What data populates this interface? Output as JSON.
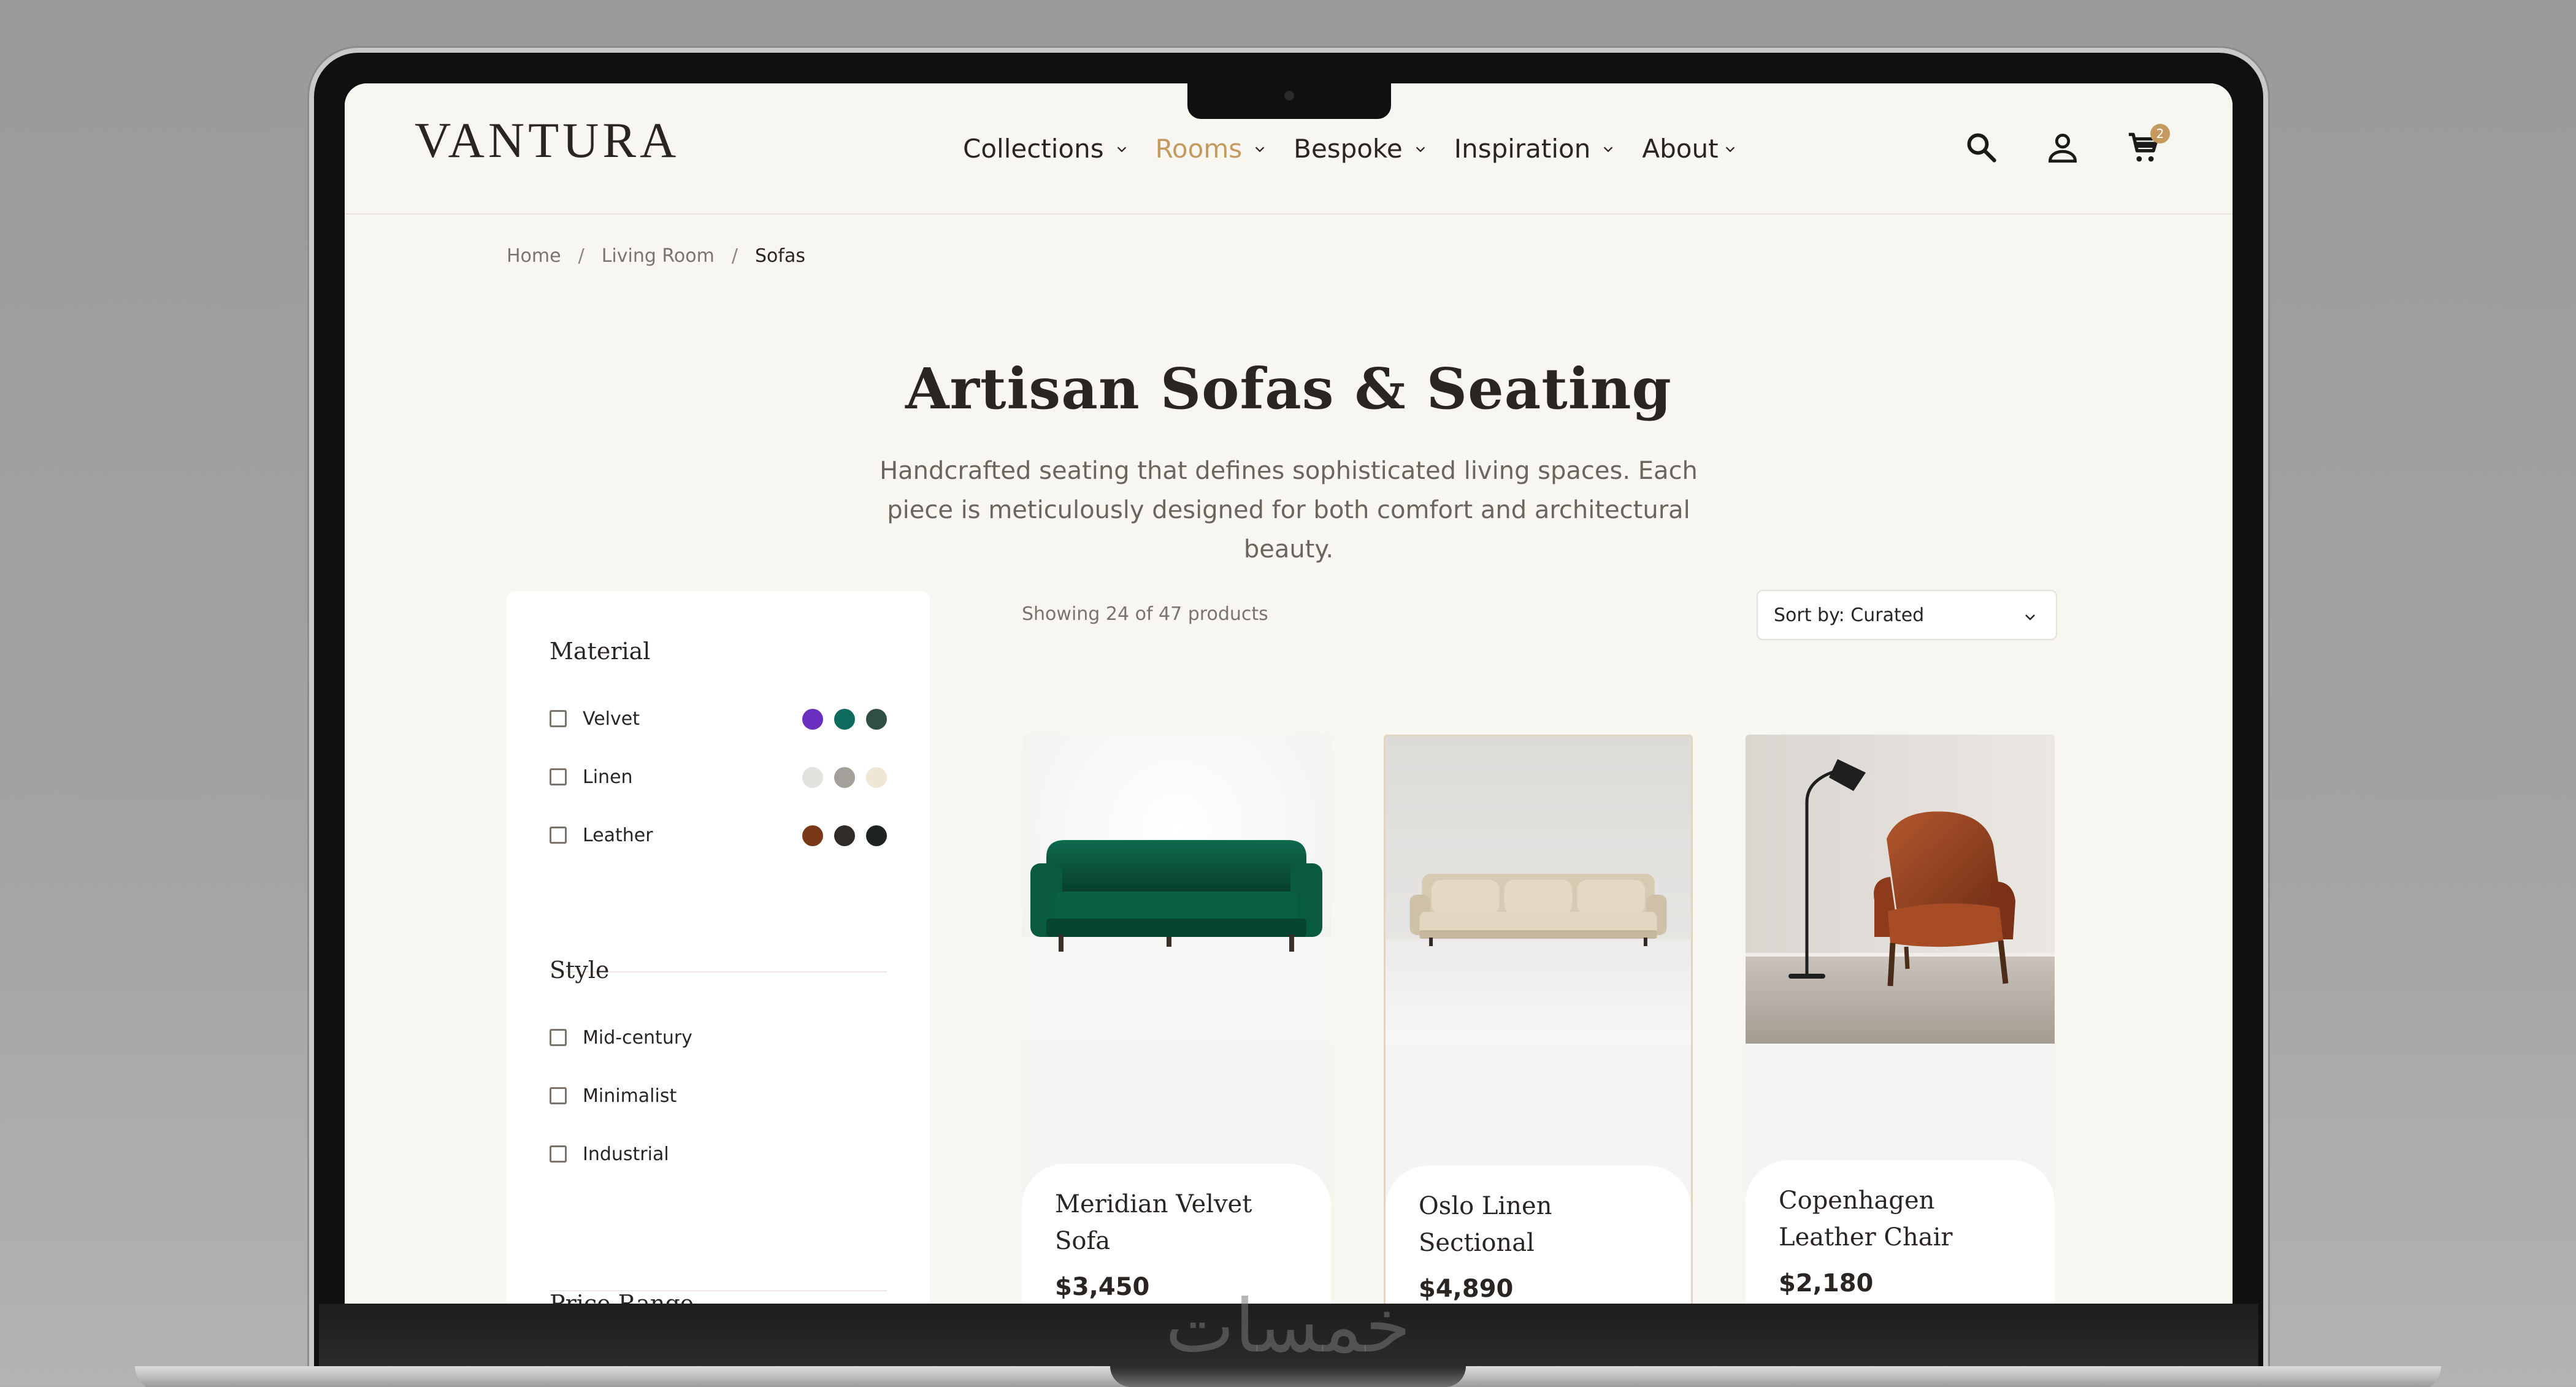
{
  "brand": {
    "logo": "VANTURA"
  },
  "nav": {
    "items": [
      {
        "label": "Collections",
        "active": false
      },
      {
        "label": "Rooms",
        "active": true
      },
      {
        "label": "Bespoke",
        "active": false
      },
      {
        "label": "Inspiration",
        "active": false
      },
      {
        "label": "About",
        "active": false
      }
    ],
    "icons": [
      "search-icon",
      "account-icon",
      "cart-icon"
    ],
    "cart_count": "2"
  },
  "breadcrumb": {
    "home": "Home",
    "sep1": "/",
    "room": "Living Room",
    "sep2": "/",
    "current": "Sofas"
  },
  "page": {
    "title": "Artisan Sofas & Seating",
    "description": "Handcrafted seating that defines sophisticated living spaces. Each piece is meticulously designed for both comfort and architectural beauty."
  },
  "filters": {
    "material": {
      "title": "Material",
      "options": [
        {
          "label": "Velvet",
          "swatches": [
            "#6b2fbf",
            "#0f6b5e",
            "#2f4f46"
          ]
        },
        {
          "label": "Linen",
          "swatches": [
            "#e3e2de",
            "#a39f99",
            "#efe6d3"
          ]
        },
        {
          "label": "Leather",
          "swatches": [
            "#7a3818",
            "#2f2b26",
            "#1d2422"
          ]
        }
      ]
    },
    "style": {
      "title": "Style",
      "options": [
        {
          "label": "Mid-century"
        },
        {
          "label": "Minimalist"
        },
        {
          "label": "Industrial"
        }
      ]
    },
    "price": {
      "title": "Price Range"
    }
  },
  "toolbar": {
    "showing": "Showing 24 of 47 products",
    "sort_label": "Sort by: Curated"
  },
  "products": [
    {
      "name": "Meridian Velvet Sofa",
      "price": "$3,450"
    },
    {
      "name": "Oslo Linen Sectional",
      "price": "$4,890"
    },
    {
      "name": "Copenhagen Leather Chair",
      "price": "$2,180"
    }
  ],
  "colors": {
    "accent": "#c59a5f",
    "text": "#2a2522",
    "background": "#f8f6f1"
  },
  "watermark": "خمسات"
}
